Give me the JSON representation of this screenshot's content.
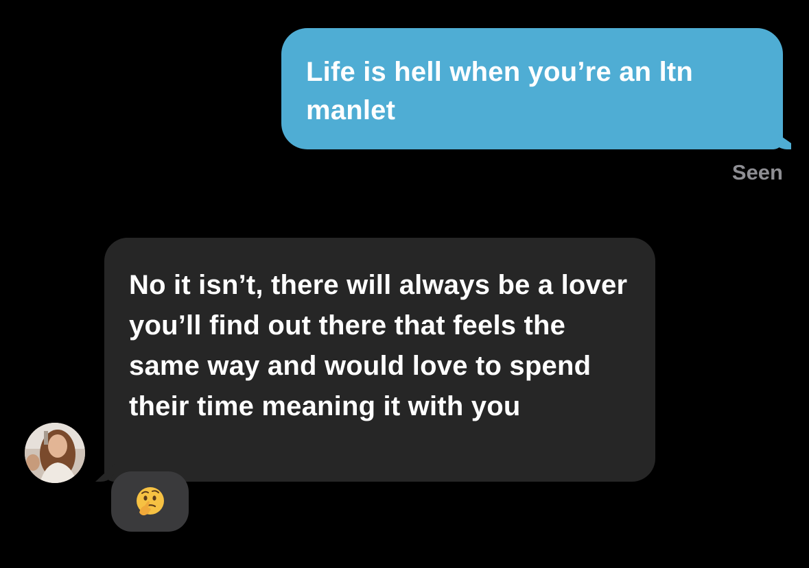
{
  "conversation": {
    "outgoing_message": {
      "text": "Life is hell when you’re an ltn manlet",
      "status": "Seen"
    },
    "incoming_message": {
      "text": "No it isn’t, there will always be a lover you’ll find out there that feels the same way and would love to spend their time meaning it with you",
      "reaction_icon": "thinking-face-emoji"
    }
  },
  "colors": {
    "background": "#000000",
    "outgoing_bubble": "#4fadd4",
    "incoming_bubble": "#262626",
    "reaction_pill": "#3a3a3c",
    "status_text": "#8e8e93"
  }
}
